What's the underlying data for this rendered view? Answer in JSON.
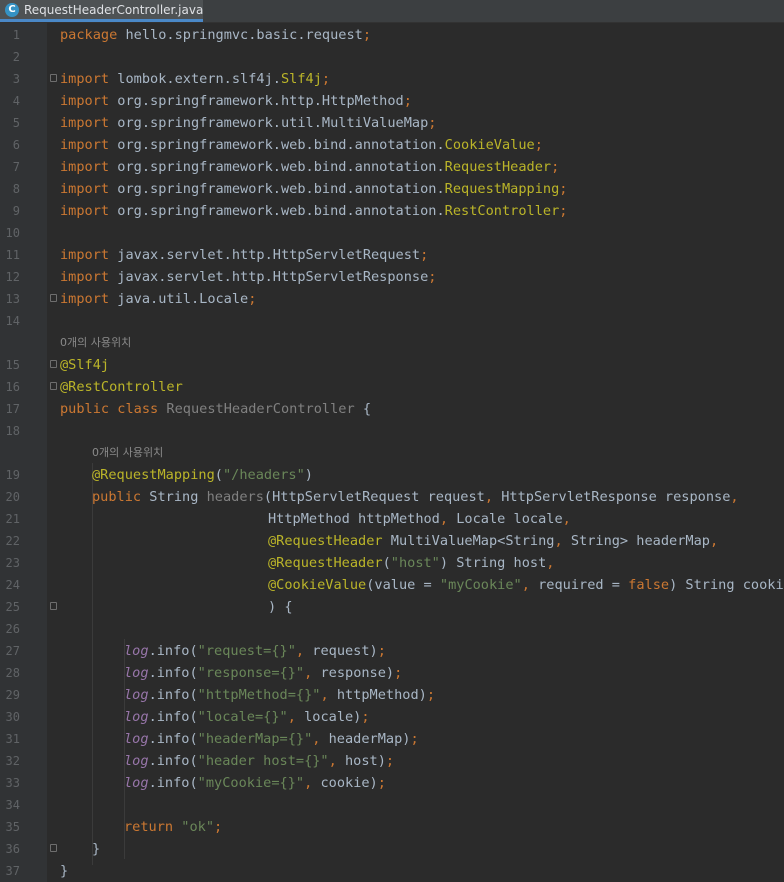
{
  "tab": {
    "label": "RequestHeaderController.java",
    "icon": "java-class-icon"
  },
  "colors": {
    "background": "#2b2b2b",
    "gutter": "#313335",
    "keyword": "#cc7832",
    "annotation": "#bbb529",
    "string": "#6a8759",
    "plain": "#a9b7c6",
    "field": "#9876aa",
    "line_number": "#606366",
    "tab_underline": "#4a88c7"
  },
  "rows": [
    {
      "ln": "1",
      "indent": 0,
      "tokens": [
        {
          "t": "package",
          "c": "kw"
        },
        {
          "t": " hello.springmvc.basic.request",
          "c": "pl"
        },
        {
          "t": ";",
          "c": "kw"
        }
      ]
    },
    {
      "ln": "2",
      "indent": 0,
      "tokens": []
    },
    {
      "ln": "3",
      "indent": 0,
      "fold": true,
      "tokens": [
        {
          "t": "import",
          "c": "kw"
        },
        {
          "t": " lombok.extern.slf4j.",
          "c": "pl"
        },
        {
          "t": "Slf4j",
          "c": "an"
        },
        {
          "t": ";",
          "c": "kw"
        }
      ]
    },
    {
      "ln": "4",
      "indent": 0,
      "tokens": [
        {
          "t": "import",
          "c": "kw"
        },
        {
          "t": " org.springframework.http.HttpMethod",
          "c": "pl"
        },
        {
          "t": ";",
          "c": "kw"
        }
      ]
    },
    {
      "ln": "5",
      "indent": 0,
      "tokens": [
        {
          "t": "import",
          "c": "kw"
        },
        {
          "t": " org.springframework.util.MultiValueMap",
          "c": "pl"
        },
        {
          "t": ";",
          "c": "kw"
        }
      ]
    },
    {
      "ln": "6",
      "indent": 0,
      "tokens": [
        {
          "t": "import",
          "c": "kw"
        },
        {
          "t": " org.springframework.web.bind.annotation.",
          "c": "pl"
        },
        {
          "t": "CookieValue",
          "c": "an"
        },
        {
          "t": ";",
          "c": "kw"
        }
      ]
    },
    {
      "ln": "7",
      "indent": 0,
      "tokens": [
        {
          "t": "import",
          "c": "kw"
        },
        {
          "t": " org.springframework.web.bind.annotation.",
          "c": "pl"
        },
        {
          "t": "RequestHeader",
          "c": "an"
        },
        {
          "t": ";",
          "c": "kw"
        }
      ]
    },
    {
      "ln": "8",
      "indent": 0,
      "tokens": [
        {
          "t": "import",
          "c": "kw"
        },
        {
          "t": " org.springframework.web.bind.annotation.",
          "c": "pl"
        },
        {
          "t": "RequestMapping",
          "c": "an"
        },
        {
          "t": ";",
          "c": "kw"
        }
      ]
    },
    {
      "ln": "9",
      "indent": 0,
      "tokens": [
        {
          "t": "import",
          "c": "kw"
        },
        {
          "t": " org.springframework.web.bind.annotation.",
          "c": "pl"
        },
        {
          "t": "RestController",
          "c": "an"
        },
        {
          "t": ";",
          "c": "kw"
        }
      ]
    },
    {
      "ln": "10",
      "indent": 0,
      "tokens": []
    },
    {
      "ln": "11",
      "indent": 0,
      "tokens": [
        {
          "t": "import",
          "c": "kw"
        },
        {
          "t": " javax.servlet.http.HttpServletRequest",
          "c": "pl"
        },
        {
          "t": ";",
          "c": "kw"
        }
      ]
    },
    {
      "ln": "12",
      "indent": 0,
      "tokens": [
        {
          "t": "import",
          "c": "kw"
        },
        {
          "t": " javax.servlet.http.HttpServletResponse",
          "c": "pl"
        },
        {
          "t": ";",
          "c": "kw"
        }
      ]
    },
    {
      "ln": "13",
      "indent": 0,
      "fold": true,
      "tokens": [
        {
          "t": "import",
          "c": "kw"
        },
        {
          "t": " java.util.Locale",
          "c": "pl"
        },
        {
          "t": ";",
          "c": "kw"
        }
      ]
    },
    {
      "ln": "14",
      "indent": 0,
      "tokens": []
    },
    {
      "ln": "",
      "indent": 0,
      "hint": "0개의 사용위치"
    },
    {
      "ln": "15",
      "indent": 0,
      "fold": true,
      "tokens": [
        {
          "t": "@Slf4j",
          "c": "an"
        }
      ]
    },
    {
      "ln": "16",
      "indent": 0,
      "fold": true,
      "tokens": [
        {
          "t": "@RestController",
          "c": "an"
        }
      ]
    },
    {
      "ln": "17",
      "indent": 0,
      "tokens": [
        {
          "t": "public class ",
          "c": "kw"
        },
        {
          "t": "RequestHeaderController",
          "c": "cl"
        },
        {
          "t": " {",
          "c": "pl"
        }
      ]
    },
    {
      "ln": "18",
      "indent": 0,
      "tokens": []
    },
    {
      "ln": "",
      "indent": 1,
      "hint": "0개의 사용위치"
    },
    {
      "ln": "19",
      "indent": 1,
      "tokens": [
        {
          "t": "@RequestMapping",
          "c": "an"
        },
        {
          "t": "(",
          "c": "pl"
        },
        {
          "t": "\"/headers\"",
          "c": "st"
        },
        {
          "t": ")",
          "c": "pl"
        }
      ]
    },
    {
      "ln": "20",
      "indent": 1,
      "tokens": [
        {
          "t": "public ",
          "c": "kw"
        },
        {
          "t": "String ",
          "c": "pl"
        },
        {
          "t": "headers",
          "c": "cl"
        },
        {
          "t": "(HttpServletRequest request",
          "c": "pl"
        },
        {
          "t": ", ",
          "c": "kw"
        },
        {
          "t": "HttpServletResponse response",
          "c": "pl"
        },
        {
          "t": ",",
          "c": "kw"
        }
      ]
    },
    {
      "ln": "21",
      "indent": 6.5,
      "tokens": [
        {
          "t": "HttpMethod httpMethod",
          "c": "pl"
        },
        {
          "t": ", ",
          "c": "kw"
        },
        {
          "t": "Locale locale",
          "c": "pl"
        },
        {
          "t": ",",
          "c": "kw"
        }
      ]
    },
    {
      "ln": "22",
      "indent": 6.5,
      "tokens": [
        {
          "t": "@RequestHeader ",
          "c": "an"
        },
        {
          "t": "MultiValueMap<String",
          "c": "pl"
        },
        {
          "t": ", ",
          "c": "kw"
        },
        {
          "t": "String> headerMap",
          "c": "pl"
        },
        {
          "t": ",",
          "c": "kw"
        }
      ]
    },
    {
      "ln": "23",
      "indent": 6.5,
      "tokens": [
        {
          "t": "@RequestHeader",
          "c": "an"
        },
        {
          "t": "(",
          "c": "pl"
        },
        {
          "t": "\"host\"",
          "c": "st"
        },
        {
          "t": ") String host",
          "c": "pl"
        },
        {
          "t": ",",
          "c": "kw"
        }
      ]
    },
    {
      "ln": "24",
      "indent": 6.5,
      "tokens": [
        {
          "t": "@CookieValue",
          "c": "an"
        },
        {
          "t": "(value = ",
          "c": "pl"
        },
        {
          "t": "\"myCookie\"",
          "c": "st"
        },
        {
          "t": ", ",
          "c": "kw"
        },
        {
          "t": "required = ",
          "c": "pl"
        },
        {
          "t": "false",
          "c": "kw"
        },
        {
          "t": ") String cookie",
          "c": "pl"
        }
      ]
    },
    {
      "ln": "25",
      "indent": 6.5,
      "fold": true,
      "tokens": [
        {
          "t": ") {",
          "c": "pl"
        }
      ]
    },
    {
      "ln": "26",
      "indent": 0,
      "tokens": []
    },
    {
      "ln": "27",
      "indent": 2,
      "tokens": [
        {
          "t": "log",
          "c": "fd"
        },
        {
          "t": ".info(",
          "c": "pl"
        },
        {
          "t": "\"request={}\"",
          "c": "st"
        },
        {
          "t": ", ",
          "c": "kw"
        },
        {
          "t": "request)",
          "c": "pl"
        },
        {
          "t": ";",
          "c": "kw"
        }
      ]
    },
    {
      "ln": "28",
      "indent": 2,
      "tokens": [
        {
          "t": "log",
          "c": "fd"
        },
        {
          "t": ".info(",
          "c": "pl"
        },
        {
          "t": "\"response={}\"",
          "c": "st"
        },
        {
          "t": ", ",
          "c": "kw"
        },
        {
          "t": "response)",
          "c": "pl"
        },
        {
          "t": ";",
          "c": "kw"
        }
      ]
    },
    {
      "ln": "29",
      "indent": 2,
      "tokens": [
        {
          "t": "log",
          "c": "fd"
        },
        {
          "t": ".info(",
          "c": "pl"
        },
        {
          "t": "\"httpMethod={}\"",
          "c": "st"
        },
        {
          "t": ", ",
          "c": "kw"
        },
        {
          "t": "httpMethod)",
          "c": "pl"
        },
        {
          "t": ";",
          "c": "kw"
        }
      ]
    },
    {
      "ln": "30",
      "indent": 2,
      "tokens": [
        {
          "t": "log",
          "c": "fd"
        },
        {
          "t": ".info(",
          "c": "pl"
        },
        {
          "t": "\"locale={}\"",
          "c": "st"
        },
        {
          "t": ", ",
          "c": "kw"
        },
        {
          "t": "locale)",
          "c": "pl"
        },
        {
          "t": ";",
          "c": "kw"
        }
      ]
    },
    {
      "ln": "31",
      "indent": 2,
      "tokens": [
        {
          "t": "log",
          "c": "fd"
        },
        {
          "t": ".info(",
          "c": "pl"
        },
        {
          "t": "\"headerMap={}\"",
          "c": "st"
        },
        {
          "t": ", ",
          "c": "kw"
        },
        {
          "t": "headerMap)",
          "c": "pl"
        },
        {
          "t": ";",
          "c": "kw"
        }
      ]
    },
    {
      "ln": "32",
      "indent": 2,
      "tokens": [
        {
          "t": "log",
          "c": "fd"
        },
        {
          "t": ".info(",
          "c": "pl"
        },
        {
          "t": "\"header host={}\"",
          "c": "st"
        },
        {
          "t": ", ",
          "c": "kw"
        },
        {
          "t": "host)",
          "c": "pl"
        },
        {
          "t": ";",
          "c": "kw"
        }
      ]
    },
    {
      "ln": "33",
      "indent": 2,
      "tokens": [
        {
          "t": "log",
          "c": "fd"
        },
        {
          "t": ".info(",
          "c": "pl"
        },
        {
          "t": "\"myCookie={}\"",
          "c": "st"
        },
        {
          "t": ", ",
          "c": "kw"
        },
        {
          "t": "cookie)",
          "c": "pl"
        },
        {
          "t": ";",
          "c": "kw"
        }
      ]
    },
    {
      "ln": "34",
      "indent": 0,
      "tokens": []
    },
    {
      "ln": "35",
      "indent": 2,
      "tokens": [
        {
          "t": "return ",
          "c": "kw"
        },
        {
          "t": "\"ok\"",
          "c": "st"
        },
        {
          "t": ";",
          "c": "kw"
        }
      ]
    },
    {
      "ln": "36",
      "indent": 1,
      "fold": true,
      "tokens": [
        {
          "t": "}",
          "c": "pl"
        }
      ]
    },
    {
      "ln": "37",
      "indent": 0,
      "tokens": [
        {
          "t": "}",
          "c": "pl"
        }
      ]
    }
  ]
}
